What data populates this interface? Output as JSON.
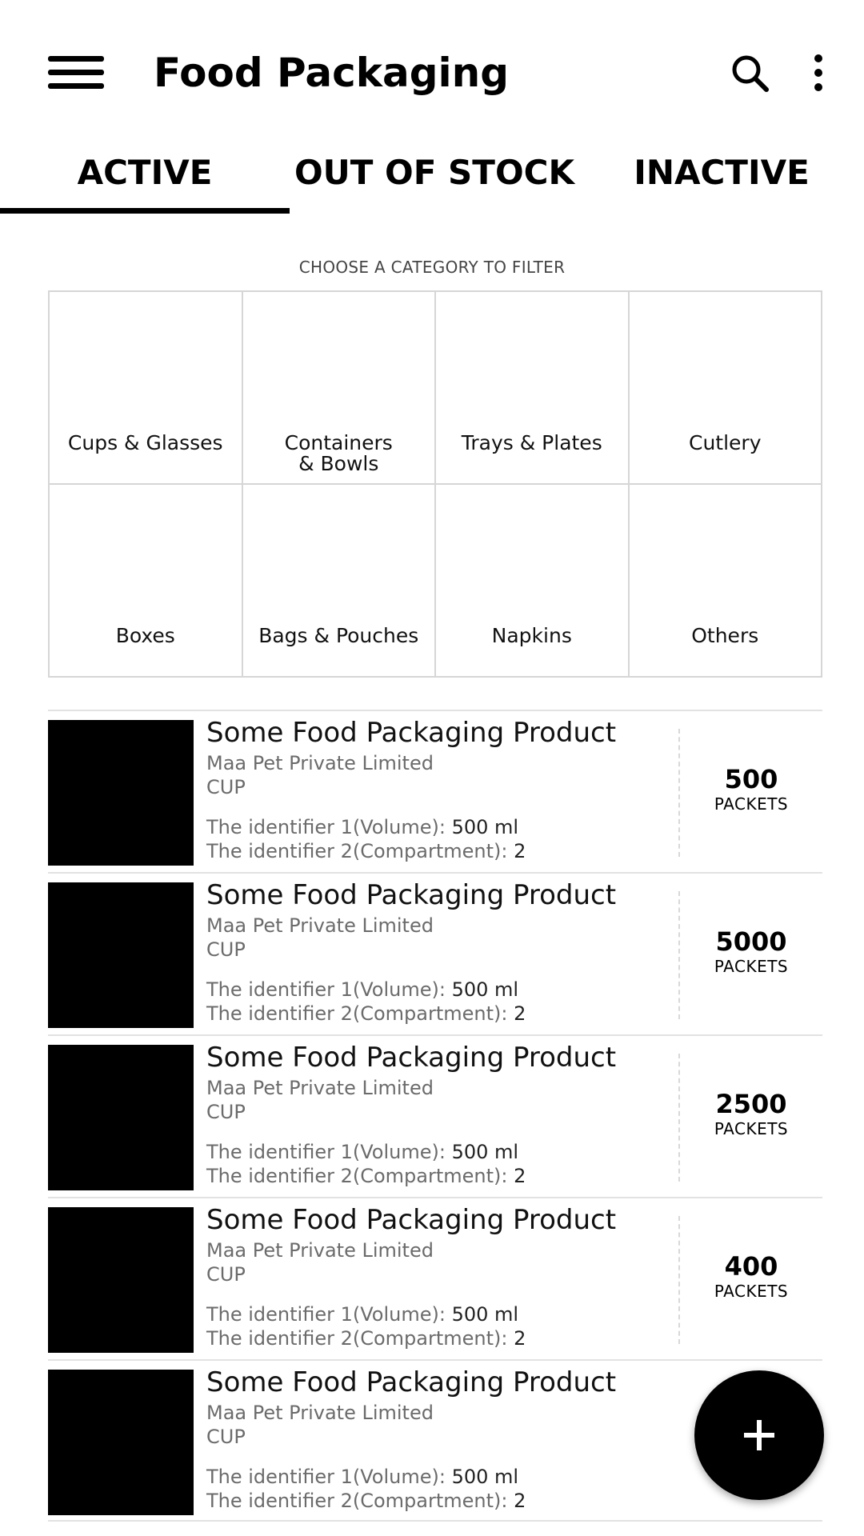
{
  "appbar": {
    "title": "Food Packaging",
    "menu_icon": "hamburger-menu-icon",
    "search_icon": "search-icon",
    "more_icon": "more-vertical-icon"
  },
  "tabs": [
    {
      "label": "ACTIVE",
      "selected": true
    },
    {
      "label": "OUT OF STOCK",
      "selected": false
    },
    {
      "label": "INACTIVE",
      "selected": false
    }
  ],
  "filter": {
    "caption": "CHOOSE A CATEGORY TO FILTER",
    "categories": [
      "Cups & Glasses",
      "Containers & Bowls",
      "Trays & Plates",
      "Cutlery",
      "Boxes",
      "Bags & Pouches",
      "Napkins",
      "Others"
    ]
  },
  "products": [
    {
      "name": "Some Food Packaging Product",
      "company": "Maa Pet Private Limited",
      "type": "CUP",
      "identifier1_label": "The identifier 1(Volume):",
      "identifier1_value": "500 ml",
      "identifier2_label": "The identifier 2(Compartment):",
      "identifier2_value": "2",
      "quantity": "500",
      "unit": "PACKETS"
    },
    {
      "name": "Some Food Packaging Product",
      "company": "Maa Pet Private Limited",
      "type": "CUP",
      "identifier1_label": "The identifier 1(Volume):",
      "identifier1_value": "500 ml",
      "identifier2_label": "The identifier 2(Compartment):",
      "identifier2_value": "2",
      "quantity": "5000",
      "unit": "PACKETS"
    },
    {
      "name": "Some Food Packaging Product",
      "company": "Maa Pet Private Limited",
      "type": "CUP",
      "identifier1_label": "The identifier 1(Volume):",
      "identifier1_value": "500 ml",
      "identifier2_label": "The identifier 2(Compartment):",
      "identifier2_value": "2",
      "quantity": "2500",
      "unit": "PACKETS"
    },
    {
      "name": "Some Food Packaging Product",
      "company": "Maa Pet Private Limited",
      "type": "CUP",
      "identifier1_label": "The identifier 1(Volume):",
      "identifier1_value": "500 ml",
      "identifier2_label": "The identifier 2(Compartment):",
      "identifier2_value": "2",
      "quantity": "400",
      "unit": "PACKETS"
    },
    {
      "name": "Some Food Packaging Product",
      "company": "Maa Pet Private Limited",
      "type": "CUP",
      "identifier1_label": "The identifier 1(Volume):",
      "identifier1_value": "500 ml",
      "identifier2_label": "The identifier 2(Compartment):",
      "identifier2_value": "2"
    }
  ],
  "fab": {
    "icon": "plus-icon"
  },
  "colors": {
    "primary": "#000000",
    "background": "#ffffff",
    "secondary_text": "#6b6b6b",
    "divider": "#e2e2e2"
  }
}
